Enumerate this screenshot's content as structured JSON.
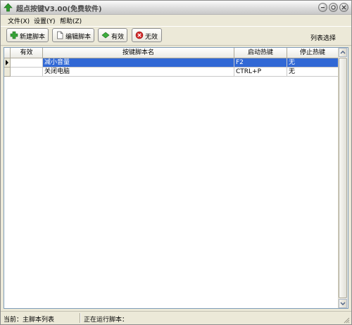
{
  "window": {
    "title": "超点按键V3.00(免费软件)"
  },
  "menu": [
    {
      "label": "文件(X)"
    },
    {
      "label": "设置(Y)"
    },
    {
      "label": "帮助(Z)"
    }
  ],
  "toolbar": {
    "new_label": "新建脚本",
    "edit_label": "编辑脚本",
    "enable_label": "有效",
    "disable_label": "无效",
    "list_select_label": "列表选择"
  },
  "table": {
    "headers": [
      "有效",
      "按键脚本名",
      "启动热键",
      "停止热键"
    ],
    "rows": [
      {
        "enabled": "",
        "name": "减小音量",
        "start_hotkey": "F2",
        "stop_hotkey": "无",
        "selected": true
      },
      {
        "enabled": "",
        "name": "关闭电脑",
        "start_hotkey": "CTRL+P",
        "stop_hotkey": "无",
        "selected": false
      }
    ]
  },
  "status": {
    "current": "当前：主脚本列表",
    "running": "正在运行脚本："
  },
  "colors": {
    "selection": "#3168d5",
    "title_text": "#4a4a4a"
  },
  "icons": {
    "app": "green-up-arrow-icon",
    "new": "green-plus-icon",
    "edit": "document-icon",
    "enable": "green-diamond-icon",
    "disable": "red-x-icon"
  }
}
